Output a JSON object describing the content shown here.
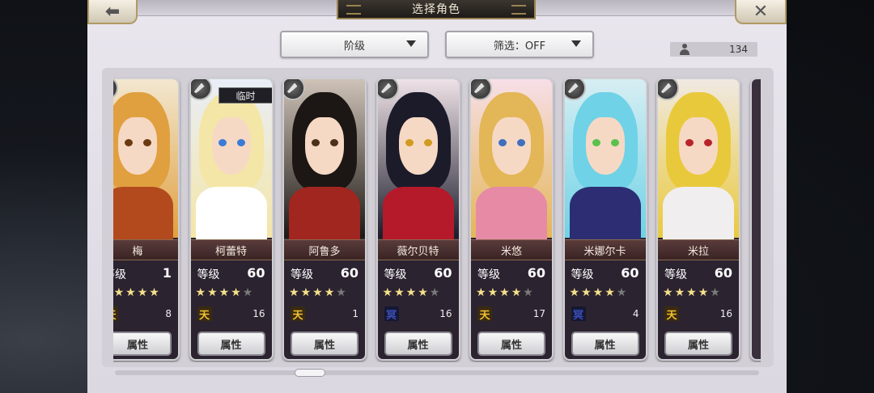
{
  "header": {
    "title": "选择角色",
    "back_icon": "left-arrow-icon",
    "close_icon": "close-x-icon"
  },
  "filters": {
    "rank_label": "阶级",
    "filter_label": "筛选：OFF"
  },
  "owned_count": "134",
  "level_label": "等级",
  "attr_button_label": "属性",
  "temp_tag": "临时",
  "elements": {
    "heaven": {
      "glyph": "天",
      "color": "#f1c232"
    },
    "underworld": {
      "glyph": "冥",
      "color": "#3b4db8"
    }
  },
  "characters": [
    {
      "name": "梅",
      "level": "1",
      "stars": 5,
      "stars_max": 5,
      "element": "heaven",
      "count": "8",
      "temp": false,
      "palette": {
        "hair": "#e0a040",
        "body": "#b34a1e",
        "eye": "#6b3a12",
        "bg": "#f2e7d0"
      }
    },
    {
      "name": "柯蕾特",
      "level": "60",
      "stars": 4,
      "stars_max": 5,
      "element": "heaven",
      "count": "16",
      "temp": true,
      "palette": {
        "hair": "#f4e6a6",
        "body": "#ffffff",
        "eye": "#3a7bd5",
        "bg": "#e9eef8"
      }
    },
    {
      "name": "阿鲁多",
      "level": "60",
      "stars": 4,
      "stars_max": 5,
      "element": "heaven",
      "count": "1",
      "temp": false,
      "palette": {
        "hair": "#1c1714",
        "body": "#a0261f",
        "eye": "#4a3118",
        "bg": "#cfc3b8"
      }
    },
    {
      "name": "薇尔贝特",
      "level": "60",
      "stars": 4,
      "stars_max": 5,
      "element": "underworld",
      "count": "16",
      "temp": false,
      "palette": {
        "hair": "#1b1b2a",
        "body": "#b51a2a",
        "eye": "#d19b1f",
        "bg": "#efe3e8"
      }
    },
    {
      "name": "米悠",
      "level": "60",
      "stars": 4,
      "stars_max": 5,
      "element": "heaven",
      "count": "17",
      "temp": false,
      "palette": {
        "hair": "#e3b657",
        "body": "#e78aa6",
        "eye": "#3f6fbf",
        "bg": "#f7dfe8"
      }
    },
    {
      "name": "米娜尔卡",
      "level": "60",
      "stars": 4,
      "stars_max": 5,
      "element": "underworld",
      "count": "4",
      "temp": false,
      "palette": {
        "hair": "#6fd2e6",
        "body": "#2c2d72",
        "eye": "#59c24c",
        "bg": "#d7eef3"
      }
    },
    {
      "name": "米拉",
      "level": "60",
      "stars": 4,
      "stars_max": 5,
      "element": "heaven",
      "count": "16",
      "temp": false,
      "palette": {
        "hair": "#e9c93c",
        "body": "#f1eef0",
        "eye": "#b8242b",
        "bg": "#f0e9e2"
      }
    }
  ]
}
